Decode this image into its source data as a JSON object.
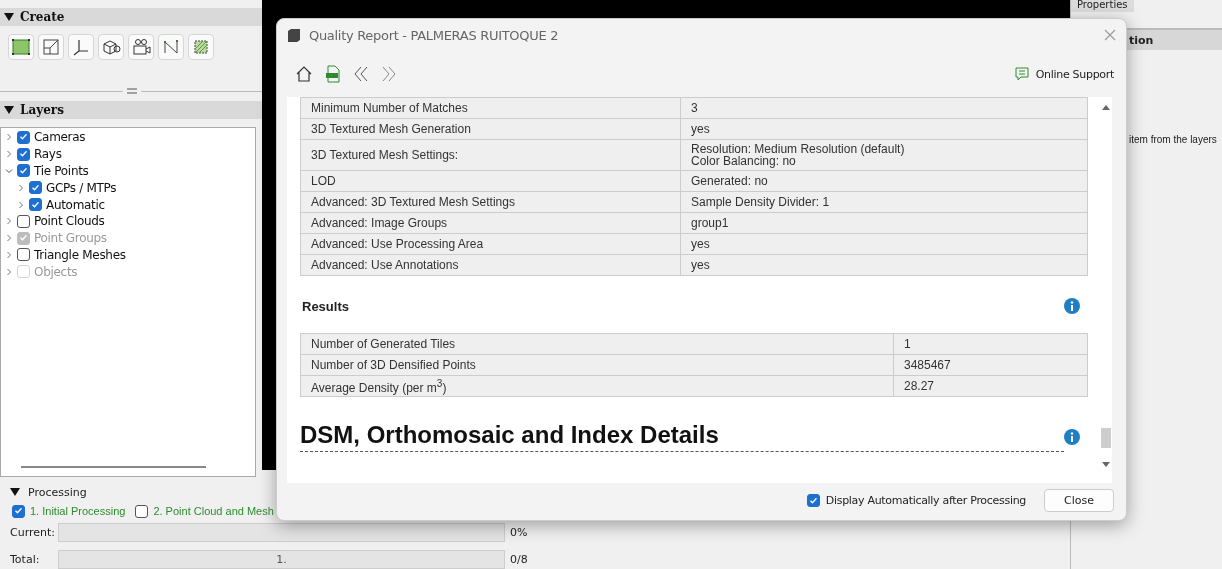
{
  "left_panel": {
    "create": {
      "title": "Create",
      "expanded": true
    },
    "layers": {
      "title": "Layers",
      "expanded": true,
      "items": [
        {
          "label": "Cameras",
          "checked": true,
          "disabled": false,
          "expanded": false
        },
        {
          "label": "Rays",
          "checked": true,
          "disabled": false,
          "expanded": false
        },
        {
          "label": "Tie Points",
          "checked": true,
          "disabled": false,
          "expanded": true,
          "children": [
            {
              "label": "GCPs / MTPs",
              "checked": true,
              "disabled": false,
              "expanded": false
            },
            {
              "label": "Automatic",
              "checked": true,
              "disabled": false,
              "expanded": false
            }
          ]
        },
        {
          "label": "Point Clouds",
          "checked": false,
          "disabled": false,
          "expanded": false
        },
        {
          "label": "Point Groups",
          "checked": true,
          "disabled": true,
          "expanded": false
        },
        {
          "label": "Triangle Meshes",
          "checked": false,
          "disabled": false,
          "expanded": false
        },
        {
          "label": "Objects",
          "checked": false,
          "disabled": true,
          "expanded": false
        }
      ]
    }
  },
  "processing": {
    "title": "Processing",
    "expanded": true,
    "steps": [
      {
        "label": "1. Initial Processing",
        "checked": true
      },
      {
        "label": "2. Point Cloud and Mesh",
        "checked": false
      }
    ],
    "progress": [
      {
        "label": "Current:",
        "level": 0,
        "reading": "0%"
      },
      {
        "label": "Total:",
        "level": 0,
        "bar_text": "1.",
        "reading": "0/8"
      }
    ]
  },
  "right_panel": {
    "tab": "Properties",
    "heading": "tion",
    "hint": "item from the layers"
  },
  "dialog": {
    "title": "Quality Report - PALMERAS RUITOQUE 2",
    "online_support": "Online Support",
    "settings_table": [
      {
        "label": "Minimum Number of Matches",
        "value": "3"
      },
      {
        "label": "3D Textured Mesh Generation",
        "value": "yes"
      },
      {
        "label": "3D Textured Mesh Settings:",
        "value": "Resolution: Medium Resolution (default)\nColor Balancing: no"
      },
      {
        "label": "LOD",
        "value": "Generated: no"
      },
      {
        "label": "Advanced: 3D Textured Mesh Settings",
        "value": "Sample Density Divider: 1"
      },
      {
        "label": "Advanced: Image Groups",
        "value": "group1"
      },
      {
        "label": "Advanced: Use Processing Area",
        "value": "yes"
      },
      {
        "label": "Advanced: Use Annotations",
        "value": "yes"
      }
    ],
    "results": {
      "title": "Results",
      "rows": [
        {
          "label": "Number of Generated Tiles",
          "value": "1"
        },
        {
          "label": "Number of 3D Densified Points",
          "value": "3485467"
        },
        {
          "label": "Average Density (per m$^{3}$)",
          "value": "28.27"
        }
      ]
    },
    "next_section": "DSM, Orthomosaic and Index Details",
    "footer": {
      "checkbox": {
        "label": "Display Automatically after Processing",
        "checked": true
      },
      "close": "Close"
    }
  }
}
